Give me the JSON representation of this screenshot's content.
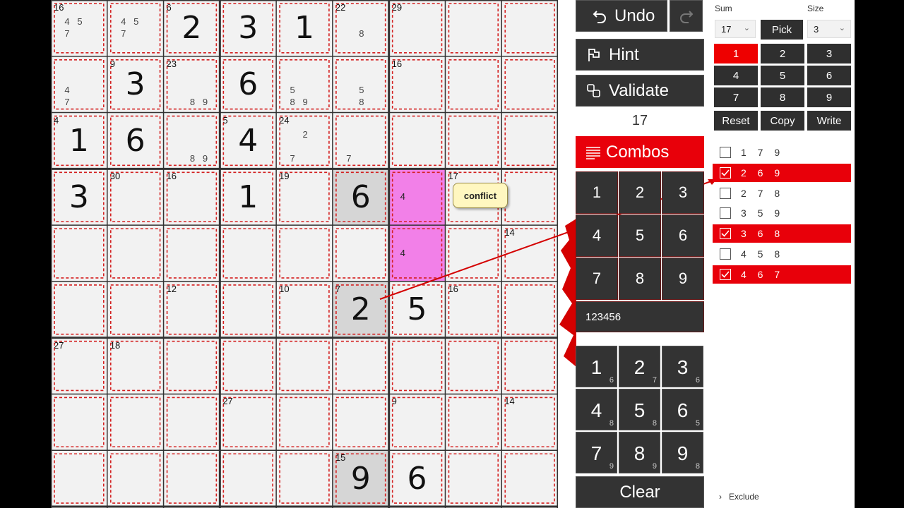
{
  "grid": {
    "cells": [
      [
        {
          "sum": "16",
          "notes": [
            "4",
            "5",
            "",
            "7",
            "",
            ""
          ]
        },
        {
          "notes": [
            "4",
            "5",
            "",
            "7",
            "",
            ""
          ]
        },
        {
          "sum": "6",
          "value": "2"
        },
        {
          "value": "3"
        },
        {
          "value": "1"
        },
        {
          "sum": "22",
          "notes": [
            "",
            "",
            "",
            "",
            "8",
            ""
          ]
        },
        {
          "sum": "29"
        },
        {},
        {}
      ],
      [
        {
          "notes": [
            "",
            "",
            "",
            "4",
            "",
            "",
            "7",
            "",
            ""
          ]
        },
        {
          "sum": "9",
          "value": "3"
        },
        {
          "sum": "23",
          "notes": [
            "",
            "",
            "",
            "",
            "",
            "",
            "",
            "8",
            "9"
          ]
        },
        {
          "value": "6"
        },
        {
          "notes": [
            "",
            "",
            "",
            "5",
            "",
            "",
            "8",
            "9",
            ""
          ]
        },
        {
          "notes": [
            "",
            "",
            "",
            "",
            "5",
            "",
            "",
            "8",
            ""
          ]
        },
        {
          "sum": "16"
        },
        {},
        {}
      ],
      [
        {
          "sum": "4",
          "value": "1"
        },
        {
          "value": "6"
        },
        {
          "notes": [
            "",
            "",
            "",
            "",
            "",
            "",
            "",
            "8",
            "9"
          ]
        },
        {
          "sum": "5",
          "value": "4"
        },
        {
          "sum": "24",
          "notes": [
            "",
            "2",
            "",
            "",
            "",
            "",
            "7",
            "",
            ""
          ]
        },
        {
          "notes": [
            "",
            "",
            "",
            "",
            "",
            "",
            "7",
            "",
            ""
          ]
        },
        {},
        {},
        {}
      ],
      [
        {
          "value": "3"
        },
        {
          "sum": "30"
        },
        {
          "sum": "16"
        },
        {
          "value": "1"
        },
        {
          "sum": "19"
        },
        {
          "value": "6",
          "shade": "gray"
        },
        {
          "shade": "pink",
          "pinknote": "4"
        },
        {
          "sum": "17"
        },
        {}
      ],
      [
        {},
        {},
        {},
        {},
        {},
        {},
        {
          "shade": "pink",
          "pinknote": "4"
        },
        {},
        {
          "sum": "14"
        }
      ],
      [
        {},
        {},
        {
          "sum": "12"
        },
        {},
        {
          "sum": "10"
        },
        {
          "sum": "7",
          "value": "2",
          "shade": "gray"
        },
        {
          "value": "5"
        },
        {
          "sum": "16"
        },
        {}
      ],
      [
        {
          "sum": "27"
        },
        {
          "sum": "18"
        },
        {},
        {},
        {},
        {},
        {},
        {},
        {}
      ],
      [
        {},
        {},
        {},
        {
          "sum": "27"
        },
        {},
        {},
        {
          "sum": "9"
        },
        {},
        {
          "sum": "14"
        }
      ],
      [
        {},
        {},
        {},
        {},
        {},
        {
          "sum": "15",
          "value": "9",
          "shade": "gray"
        },
        {
          "value": "6"
        },
        {},
        {}
      ]
    ]
  },
  "tooltip": {
    "text": "conflict"
  },
  "toolbar": {
    "undo_label": "Undo",
    "hint_label": "Hint",
    "validate_label": "Validate",
    "current_sum": "17",
    "combos_label": "Combos",
    "clear_label": "Clear"
  },
  "keypad_top": {
    "keys": [
      "1",
      "2",
      "3",
      "4",
      "5",
      "6",
      "7",
      "8",
      "9"
    ],
    "entry": "123456"
  },
  "keypad_bottom": {
    "keys": [
      {
        "n": "1",
        "c": "6"
      },
      {
        "n": "2",
        "c": "7"
      },
      {
        "n": "3",
        "c": "6"
      },
      {
        "n": "4",
        "c": "8"
      },
      {
        "n": "5",
        "c": "8"
      },
      {
        "n": "6",
        "c": "5"
      },
      {
        "n": "7",
        "c": "9"
      },
      {
        "n": "8",
        "c": "9"
      },
      {
        "n": "9",
        "c": "8"
      }
    ]
  },
  "sidebar": {
    "sum_label": "Sum",
    "size_label": "Size",
    "sum_value": "17",
    "size_value": "3",
    "pick_label": "Pick",
    "digits": [
      "1",
      "2",
      "3",
      "4",
      "5",
      "6",
      "7",
      "8",
      "9"
    ],
    "selected_digit": "1",
    "reset_label": "Reset",
    "copy_label": "Copy",
    "write_label": "Write",
    "combos": [
      {
        "text": "1 7 9",
        "checked": false
      },
      {
        "text": "2 6 9",
        "checked": true
      },
      {
        "text": "2 7 8",
        "checked": false
      },
      {
        "text": "3 5 9",
        "checked": false
      },
      {
        "text": "3 6 8",
        "checked": true
      },
      {
        "text": "4 5 8",
        "checked": false
      },
      {
        "text": "4 6 7",
        "checked": true
      }
    ],
    "exclude_label": "Exclude"
  },
  "colors": {
    "accent": "#e8000a",
    "dark": "#333333",
    "pink": "#f280e8",
    "gray": "#d6d6d6"
  }
}
